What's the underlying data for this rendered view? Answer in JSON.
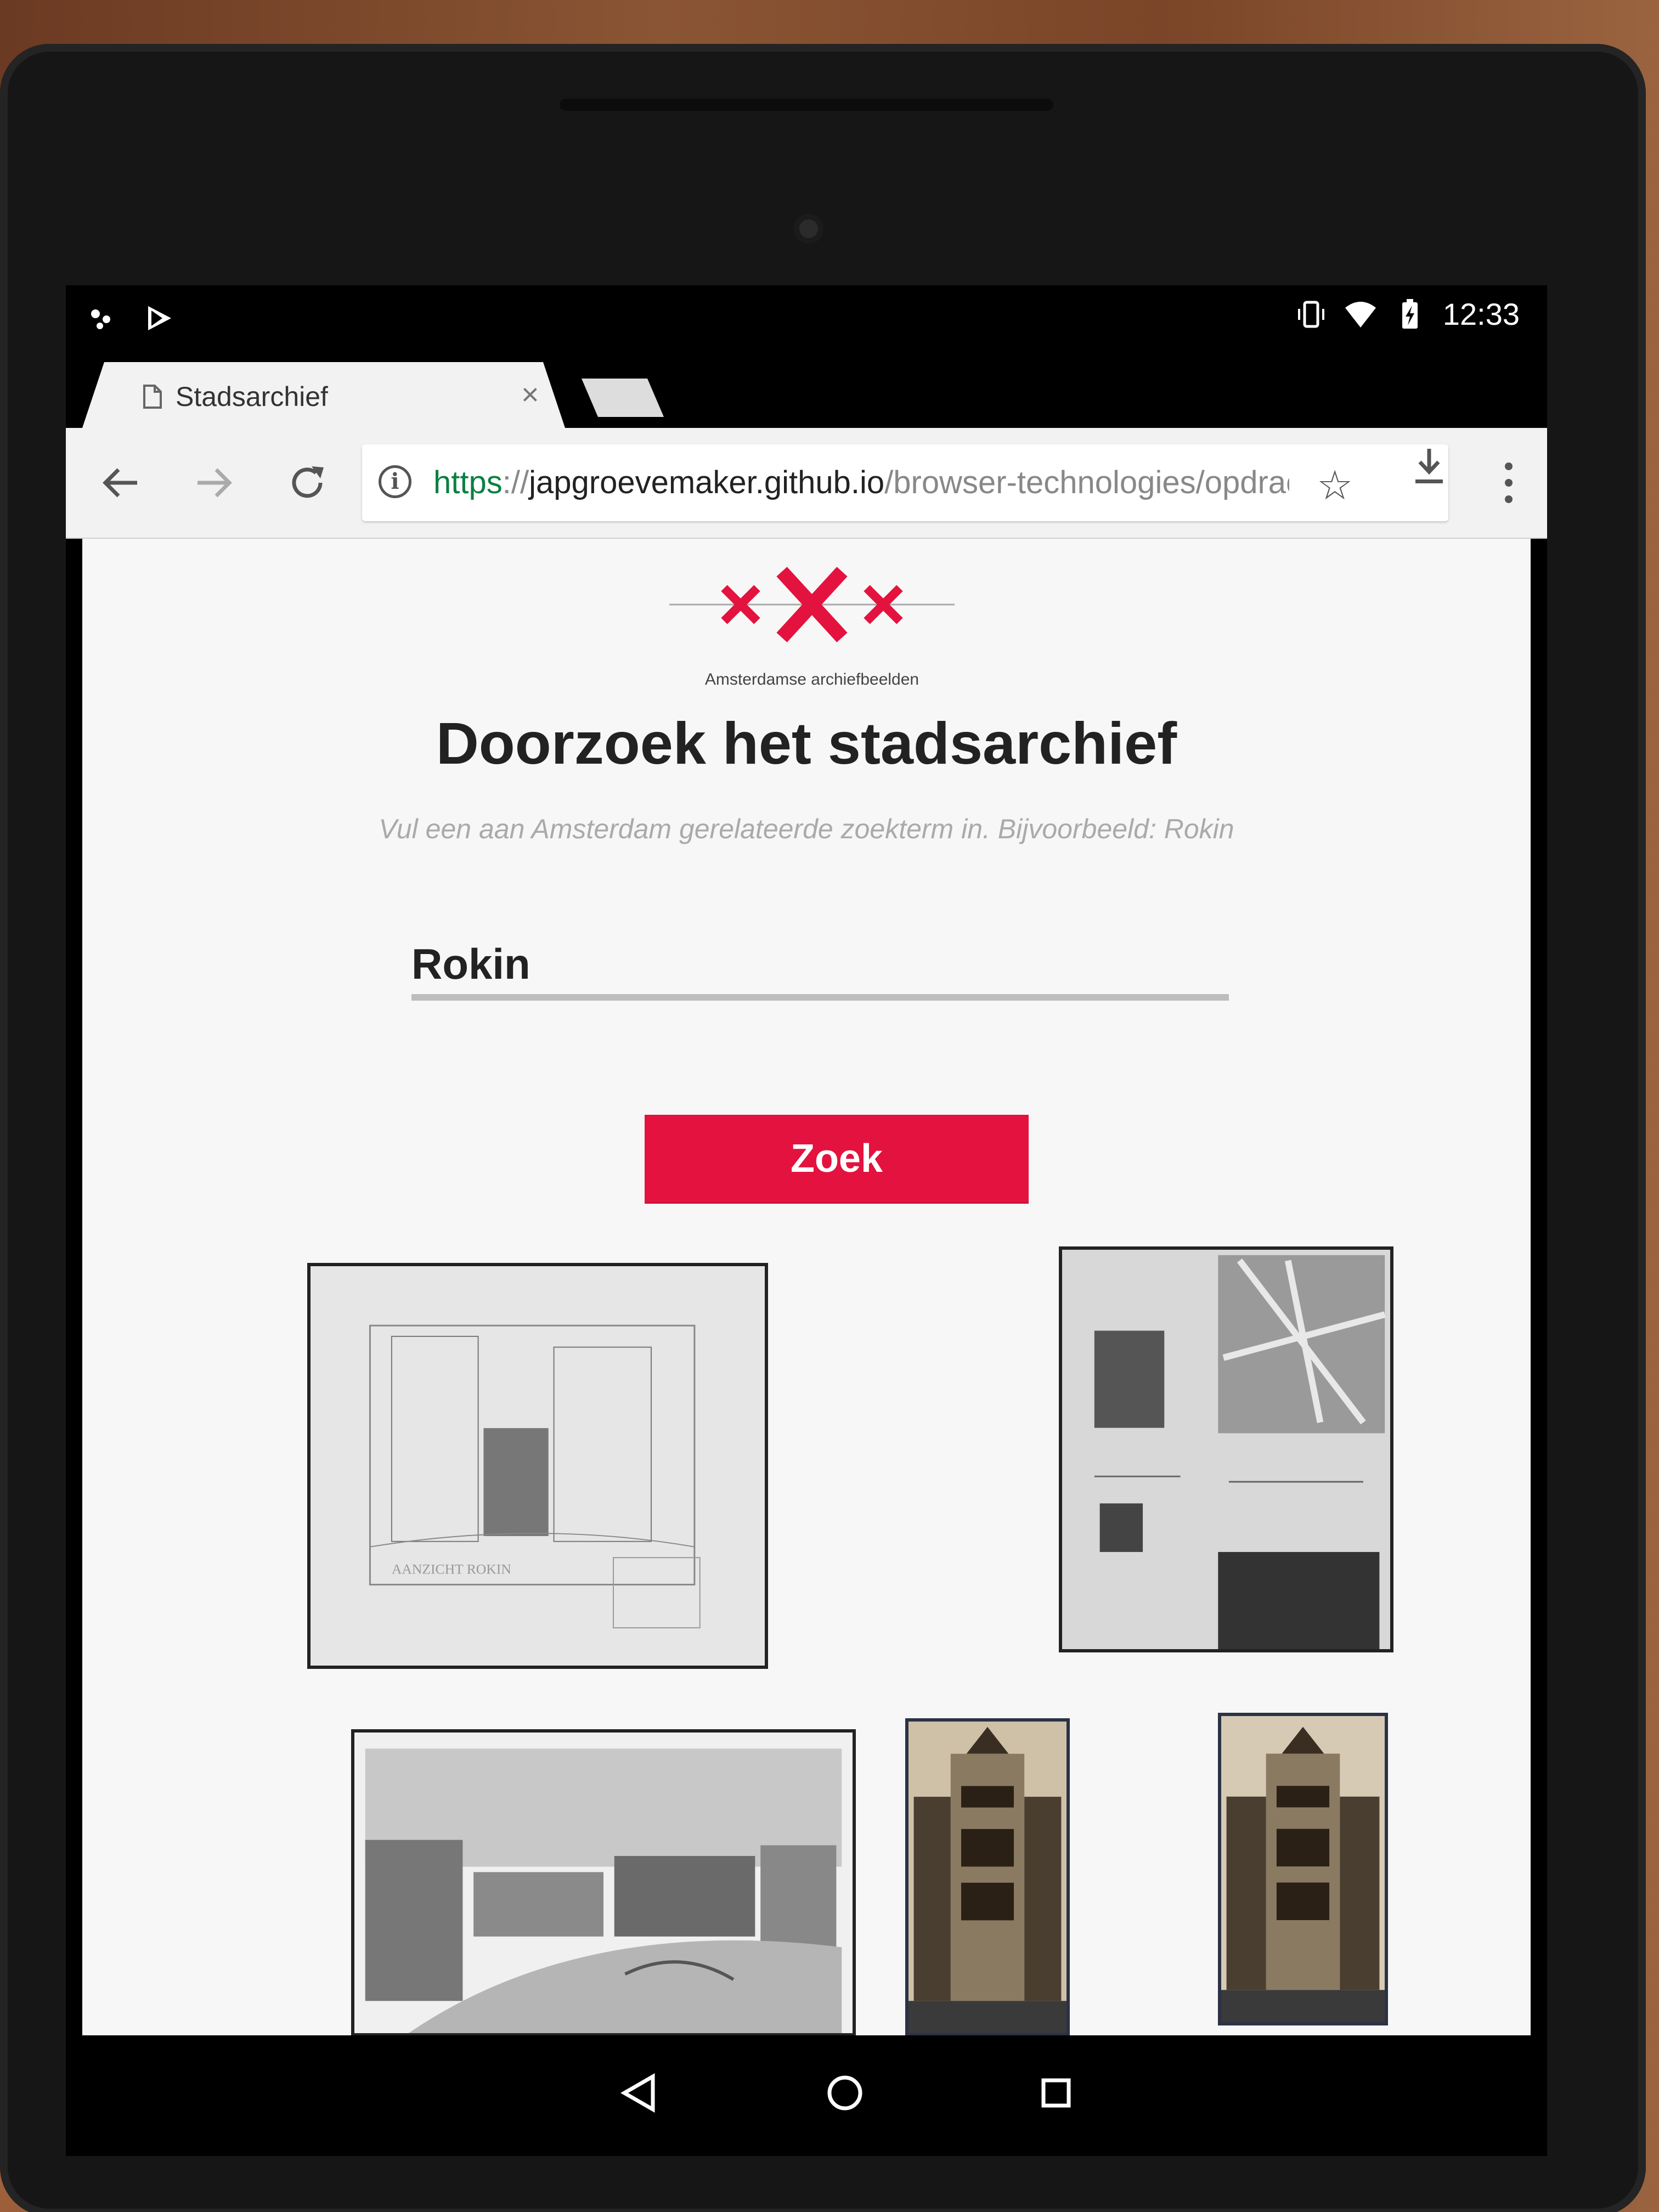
{
  "status_bar": {
    "time": "12:33",
    "left_icons": [
      "notification-dots-icon",
      "play-store-icon"
    ],
    "right_icons": [
      "vibrate-icon",
      "wifi-icon",
      "battery-charging-icon"
    ]
  },
  "browser": {
    "tab": {
      "title": "Stadsarchief",
      "icon": "document-icon",
      "close_label": "×"
    },
    "url": {
      "scheme": "https",
      "separator": "://",
      "host": "japgroevemaker.github.io",
      "path": "/browser-technologies/opdrach"
    }
  },
  "page": {
    "logo_caption": "Amsterdamse archiefbeelden",
    "heading": "Doorzoek het stadsarchief",
    "subtitle": "Vul een aan Amsterdam gerelateerde zoekterm in. Bijvoorbeeld: Rokin",
    "search": {
      "value": "Rokin"
    },
    "search_button_label": "Zoek",
    "results": [
      {
        "kind": "architectural-sketch",
        "caption": "AANZICHT ROKIN"
      },
      {
        "kind": "blueprint-plan"
      },
      {
        "kind": "street-illustration"
      },
      {
        "kind": "building-photo"
      },
      {
        "kind": "building-photo"
      }
    ]
  },
  "colors": {
    "accent": "#e4123e",
    "logo_cross": "#e4123e",
    "url_scheme": "#0b8043"
  },
  "navigation": {
    "icons": [
      "back-triangle-icon",
      "home-circle-icon",
      "recents-square-icon"
    ]
  }
}
